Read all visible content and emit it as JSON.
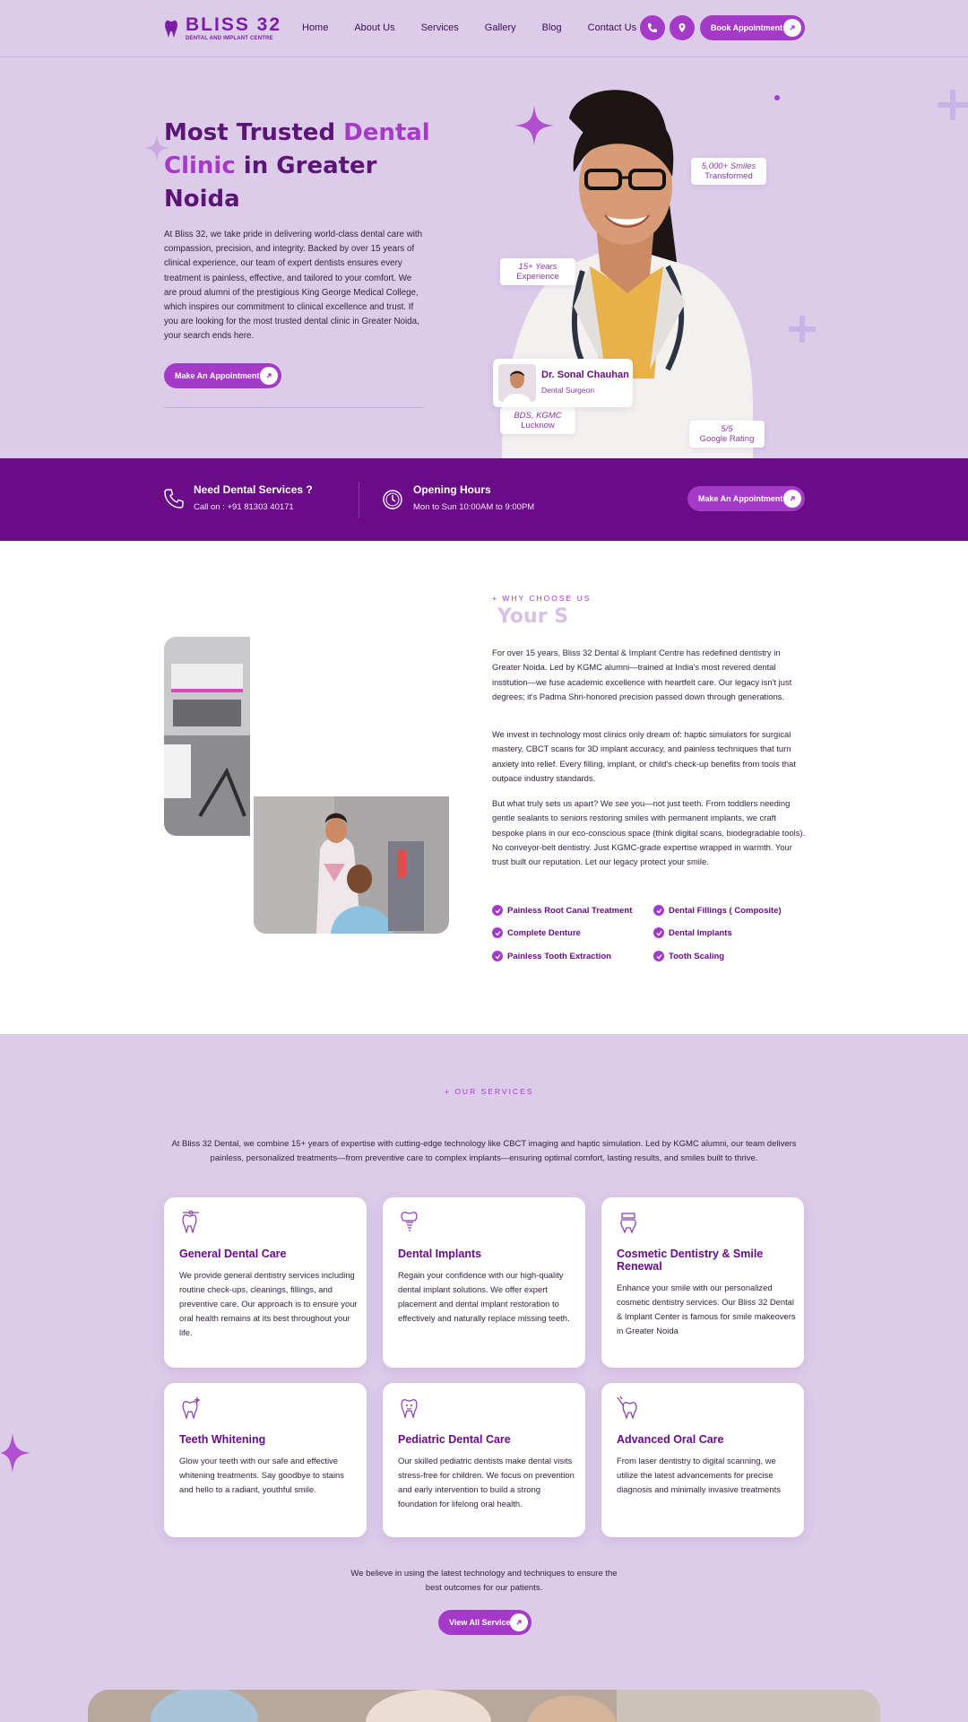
{
  "brand": {
    "name": "BLISS 32",
    "tagline": "DENTAL AND IMPLANT CENTRE",
    "accent": "#a53ac8",
    "dark": "#6a0c87"
  },
  "nav": {
    "items": [
      "Home",
      "About Us",
      "Services",
      "Gallery",
      "Blog",
      "Contact Us"
    ],
    "phone_icon": "phone-icon",
    "location_icon": "location-pin-icon",
    "cta": "Book Appointment"
  },
  "hero": {
    "title_part1": "Most Trusted ",
    "title_hl1": "Dental",
    "title_hl2": "Clinic",
    "title_part2": " in Greater Noida",
    "paragraph": "At Bliss 32, we take pride in delivering world-class dental care with compassion, precision, and integrity. Backed by over 15 years of clinical experience, our team of expert dentists ensures every treatment is painless, effective, and tailored to your comfort. We are proud alumni of the prestigious King George Medical College, which inspires our commitment to clinical excellence and trust. If you are looking for the most trusted dental clinic in Greater Noida, your search ends here.",
    "cta": "Make An Appointment",
    "badges": {
      "smiles_top": "5,000+ Smiles",
      "smiles_bottom": "Transformed",
      "years_top": "15+ Years",
      "years_bottom": "Experience",
      "degree_top": "BDS, KGMC",
      "degree_bottom": "Lucknow",
      "rating_top": "5/5",
      "rating_bottom": "Google Rating"
    },
    "doctor": {
      "name": "Dr. Sonal Chauhan",
      "role": "Dental Surgeon"
    }
  },
  "info_bar": {
    "services_title": "Need Dental Services ?",
    "services_sub": "Call on : +91 81303 40171",
    "hours_title": "Opening Hours",
    "hours_sub": "Mon to Sun 10:00AM to 9:00PM",
    "cta": "Make An Appointment"
  },
  "about": {
    "eyebrow": "+ WHY CHOOSE US",
    "heading": "Your S",
    "p1": "For over 15 years, Bliss 32 Dental & Implant Centre has redefined dentistry in Greater Noida. Led by KGMC alumni—trained at India's most revered dental institution—we fuse academic excellence with heartfelt care. Our legacy isn't just degrees; it's Padma Shri-honored precision passed down through generations.",
    "p2": "We invest in technology most clinics only dream of: haptic simulators for surgical mastery, CBCT scans for 3D implant accuracy, and painless techniques that turn anxiety into relief. Every filling, implant, or child's check-up benefits from tools that outpace industry standards.",
    "p3": "But what truly sets us apart? We see you—not just teeth. From toddlers needing gentle sealants to seniors restoring smiles with permanent implants, we craft bespoke plans in our eco-conscious space (think digital scans, biodegradable tools). No conveyor-belt dentistry. Just KGMC-grade expertise wrapped in warmth. Your trust built our reputation. Let our legacy protect your smile.",
    "checks": [
      "Painless Root Canal Treatment",
      "Dental Fillings ( Composite)",
      "Complete Denture",
      "Dental Implants",
      "Painless Tooth Extraction",
      "Tooth Scaling"
    ]
  },
  "services": {
    "eyebrow": "+ OUR SERVICES",
    "intro": "At Bliss 32 Dental, we combine 15+ years of expertise with cutting-edge technology like CBCT imaging and haptic simulation. Led by KGMC alumni, our team delivers painless, personalized treatments—from preventive care to complex implants—ensuring optimal comfort, lasting results, and smiles built to thrive.",
    "cards": [
      {
        "title": "General Dental Care",
        "desc": "We provide general dentistry services including routine check-ups, cleanings, fillings, and preventive care. Our approach is to ensure your oral health remains at its best throughout your life.",
        "icon": "tooth-checkup-icon"
      },
      {
        "title": "Dental Implants",
        "desc": "Regain your confidence with our high-quality dental implant solutions. We offer expert placement and dental implant restoration to effectively and naturally replace missing teeth.",
        "icon": "tooth-implant-icon"
      },
      {
        "title": "Cosmetic Dentistry & Smile Renewal",
        "desc": "Enhance your smile with our personalized cosmetic dentistry services. Our Bliss 32 Dental & Implant Center is famous for smile makeovers in Greater Noida",
        "icon": "tooth-crown-icon"
      },
      {
        "title": "Teeth Whitening",
        "desc": "Glow your teeth with our safe and effective whitening treatments. Say goodbye to stains and hello to a radiant, youthful smile.",
        "icon": "tooth-sparkle-icon"
      },
      {
        "title": "Pediatric Dental Care",
        "desc": "Our skilled pediatric dentists make dental visits stress-free for children. We focus on prevention and early intervention to build a strong foundation for lifelong oral health.",
        "icon": "child-tooth-icon"
      },
      {
        "title": "Advanced Oral Care",
        "desc": "From laser dentistry to digital scanning, we utilize the latest advancements for precise diagnosis and minimally invasive treatments",
        "icon": "dental-tools-icon"
      }
    ],
    "footer": "We believe in using the latest technology and techniques to ensure the best outcomes for our patients.",
    "cta": "View All Service"
  }
}
